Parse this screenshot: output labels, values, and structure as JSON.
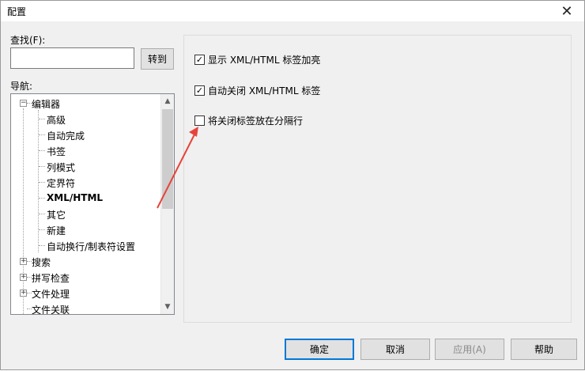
{
  "window": {
    "title": "配置",
    "close_glyph": "✕"
  },
  "find": {
    "label": "查找(F):",
    "value": "",
    "goto_label": "转到"
  },
  "nav": {
    "label": "导航:",
    "editor": {
      "label": "编辑器",
      "children": [
        "高级",
        "自动完成",
        "书签",
        "列模式",
        "定界符",
        "XML/HTML",
        "其它",
        "新建",
        "自动换行/制表符设置"
      ],
      "selected": "XML/HTML"
    },
    "others": [
      {
        "label": "搜索",
        "expand": "+"
      },
      {
        "label": "拼写检查",
        "expand": "+"
      },
      {
        "label": "文件处理",
        "expand": "+"
      },
      {
        "label": "文件关联",
        "expand": ""
      }
    ],
    "collapse_glyph": "−"
  },
  "options": [
    {
      "label": "显示 XML/HTML 标签加亮",
      "checked": true
    },
    {
      "label": "自动关闭 XML/HTML 标签",
      "checked": true
    },
    {
      "label": "将关闭标签放在分隔行",
      "checked": false
    }
  ],
  "buttons": {
    "ok": "确定",
    "cancel": "取消",
    "apply": "应用(A)",
    "help": "帮助"
  },
  "annotation": {
    "color": "#e8423a"
  }
}
